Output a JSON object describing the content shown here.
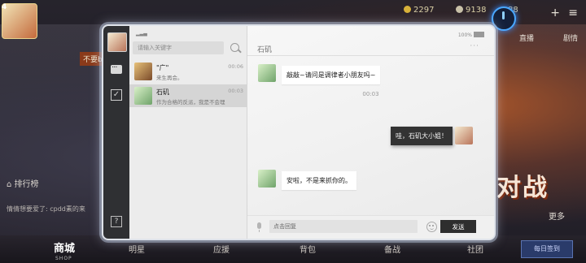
{
  "hud": {
    "level": "4",
    "currency_a": "2297",
    "currency_b": "9138",
    "currency_c": "88",
    "side_tag": "不要b",
    "rank_label": "排行榜",
    "tip_text": "情倩想要爱了: cpdd素的来",
    "right_label_1": "直播",
    "right_label_2": "剧情",
    "fight_label": "对战",
    "more_label": "更多",
    "nav_shop": "商城",
    "nav_shop_sub": "SHOP",
    "nav_items": [
      "明星",
      "应援",
      "背包",
      "备战",
      "社团"
    ],
    "nav_right_btn": "每日签到",
    "icons": {
      "power": "power-icon",
      "plus": "plus-icon"
    },
    "colors": {
      "accent_blue": "#4aa8ff",
      "panel_dark": "#2f3033"
    }
  },
  "chat": {
    "search_placeholder": "请输入关键字",
    "battery_text": "100%",
    "contacts": [
      {
        "name": "\"广\"",
        "preview": "来生再会。",
        "time": "00:06",
        "active": false
      },
      {
        "name": "石矶",
        "preview": "作为合格的反派，我是不会理",
        "time": "00:03",
        "active": true
      }
    ],
    "title": "石矶",
    "menu_dots": "···",
    "messages": [
      {
        "side": "left",
        "text": "敲敲~请问是调律者小朋友吗~"
      },
      {
        "time": "00:03"
      },
      {
        "side": "right",
        "text": "哇，石矶大小姐！"
      },
      {
        "side": "left",
        "text": "安啦，不是来抓你的。"
      }
    ],
    "reply_placeholder": "点击回复",
    "send_label": "发送",
    "help_label": "?"
  }
}
